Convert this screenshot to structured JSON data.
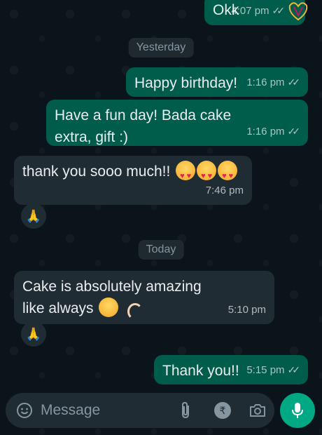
{
  "messages": [
    {
      "text": "Okk",
      "time": "4:07 pm",
      "direction": "outgoing",
      "status": "read"
    },
    {
      "text": "Happy birthday!",
      "time": "1:16 pm",
      "direction": "outgoing",
      "status": "read"
    },
    {
      "text": "Have a fun day! Bada cake extra, gift :)",
      "time": "1:16 pm",
      "direction": "outgoing",
      "status": "read"
    },
    {
      "text": "thank you sooo much!!",
      "emoji": [
        "smiling-face-with-hearts",
        "smiling-face-with-hearts",
        "smiling-face-with-hearts"
      ],
      "time": "7:46 pm",
      "direction": "incoming",
      "reaction": "folded-hands"
    },
    {
      "text": "Cake is absolutely amazing like always",
      "emoji": [
        "heart-eyes",
        "ok-hand"
      ],
      "time": "5:10 pm",
      "direction": "incoming",
      "reaction": "folded-hands"
    },
    {
      "text": "Thank you!!",
      "time": "5:15 pm",
      "direction": "outgoing",
      "status": "read"
    }
  ],
  "date_separators": [
    "Yesterday",
    "Today"
  ],
  "composer": {
    "placeholder": "Message",
    "icons": [
      "emoji-icon",
      "attach-icon",
      "rupee-payment-icon",
      "camera-icon",
      "mic-icon"
    ]
  },
  "colors": {
    "background": "#0b141a",
    "outgoing_bubble": "#005c4b",
    "incoming_bubble": "#202c33",
    "accent": "#00a884"
  }
}
